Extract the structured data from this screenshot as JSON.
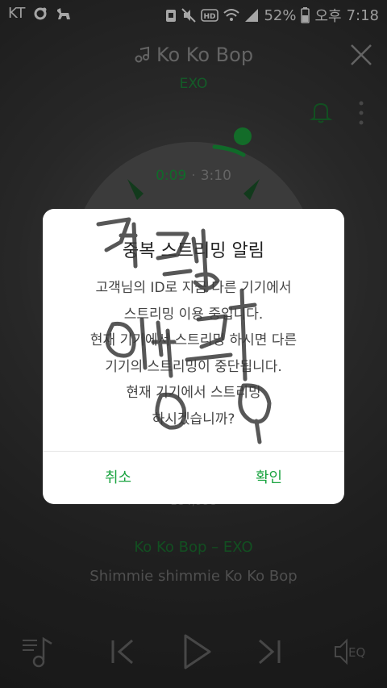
{
  "status_bar": {
    "carrier": "KT",
    "battery": "52%",
    "ampm": "오후",
    "time": "7:18",
    "icons": [
      "circle-notification-icon",
      "dog-notification-icon",
      "storage-icon",
      "mute-icon",
      "hd-icon",
      "wifi-icon",
      "signal-icon",
      "battery-icon"
    ]
  },
  "player": {
    "song_title": "Ko Ko Bop",
    "artist": "EXO",
    "current_time": "0:09",
    "total_time": "3:10",
    "time_separator": "·",
    "progress": 0.047,
    "play_count": "184,998",
    "lyric_title": "Ko Ko Bop – EXO",
    "lyric_line": "Shimmie shimmie Ko Ko Bop"
  },
  "dialog": {
    "title": "중복 스트리밍 알림",
    "message_lines": [
      "고객님의 ID로 지금 다른 기기에서",
      "스트리밍 이용 중입니다.",
      "현재 기기에서 스트리밍 하시면 다른",
      "기기의 스트리밍이 중단됩니다.",
      "현재 기기에서 스트리밍",
      "하시겠습니까?"
    ],
    "cancel_label": "취소",
    "confirm_label": "확인"
  },
  "controls": {
    "eq_label": "EQ"
  },
  "colors": {
    "accent_green": "#1aa340",
    "dim_green": "#1c7a33",
    "dialog_bg": "#ffffff"
  }
}
